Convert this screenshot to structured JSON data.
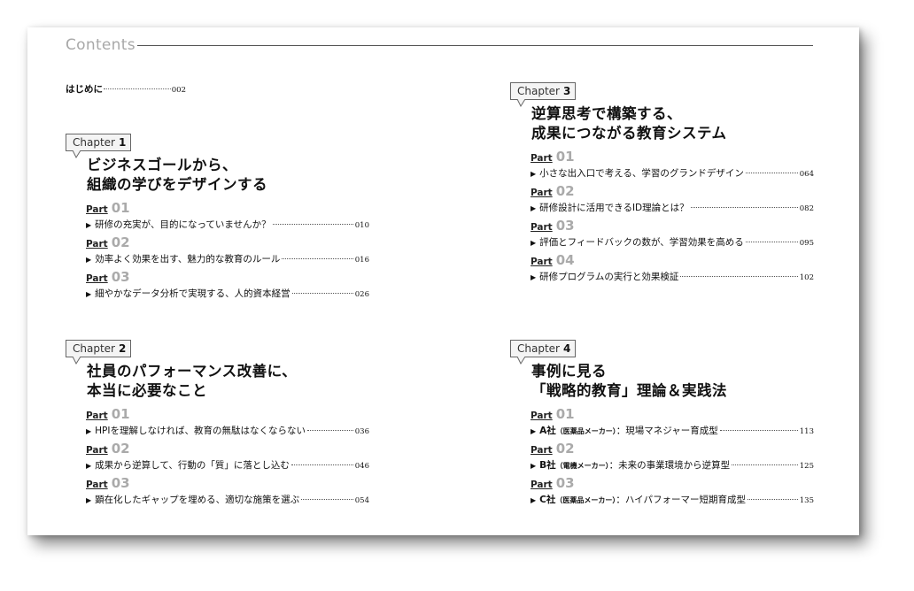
{
  "header": {
    "title": "Contents"
  },
  "intro": {
    "label": "はじめに",
    "page": "002"
  },
  "part_word": "Part",
  "chapters": [
    {
      "label": "Chapter",
      "number": "1",
      "title_lines": [
        "ビジネスゴールから、",
        "組織の学びをデザインする"
      ],
      "parts": [
        {
          "num": "01",
          "text": "研修の充実が、目的になっていませんか？",
          "page": "010"
        },
        {
          "num": "02",
          "text": "効率よく効果を出す、魅力的な教育のルール",
          "page": "016"
        },
        {
          "num": "03",
          "text": "細やかなデータ分析で実現する、人的資本経営",
          "page": "026"
        }
      ]
    },
    {
      "label": "Chapter",
      "number": "2",
      "title_lines": [
        "社員のパフォーマンス改善に、",
        "本当に必要なこと"
      ],
      "parts": [
        {
          "num": "01",
          "text": "HPIを理解しなければ、教育の無駄はなくならない",
          "page": "036"
        },
        {
          "num": "02",
          "text": "成果から逆算して、行動の「質」に落とし込む",
          "page": "046"
        },
        {
          "num": "03",
          "text": "顕在化したギャップを埋める、適切な施策を選ぶ",
          "page": "054"
        }
      ]
    },
    {
      "label": "Chapter",
      "number": "3",
      "title_lines": [
        "逆算思考で構築する、",
        "成果につながる教育システム"
      ],
      "parts": [
        {
          "num": "01",
          "text": "小さな出入口で考える、学習のグランドデザイン",
          "page": "064"
        },
        {
          "num": "02",
          "text": "研修設計に活用できるID理論とは？",
          "page": "082"
        },
        {
          "num": "03",
          "text": "評価とフィードバックの数が、学習効果を高める",
          "page": "095"
        },
        {
          "num": "04",
          "text": "研修プログラムの実行と効果検証",
          "page": "102"
        }
      ]
    },
    {
      "label": "Chapter",
      "number": "4",
      "title_lines": [
        "事例に見る",
        "「戦略的教育」理論＆実践法"
      ],
      "parts": [
        {
          "num": "01",
          "company": "A社",
          "industry": "（医薬品メーカー）",
          "text": "：現場マネジャー育成型",
          "page": "113"
        },
        {
          "num": "02",
          "company": "B社",
          "industry": "（電機メーカー）",
          "text": "：未来の事業環境から逆算型",
          "page": "125"
        },
        {
          "num": "03",
          "company": "C社",
          "industry": "（医薬品メーカー）",
          "text": "：ハイパフォーマー短期育成型",
          "page": "135"
        }
      ]
    }
  ]
}
